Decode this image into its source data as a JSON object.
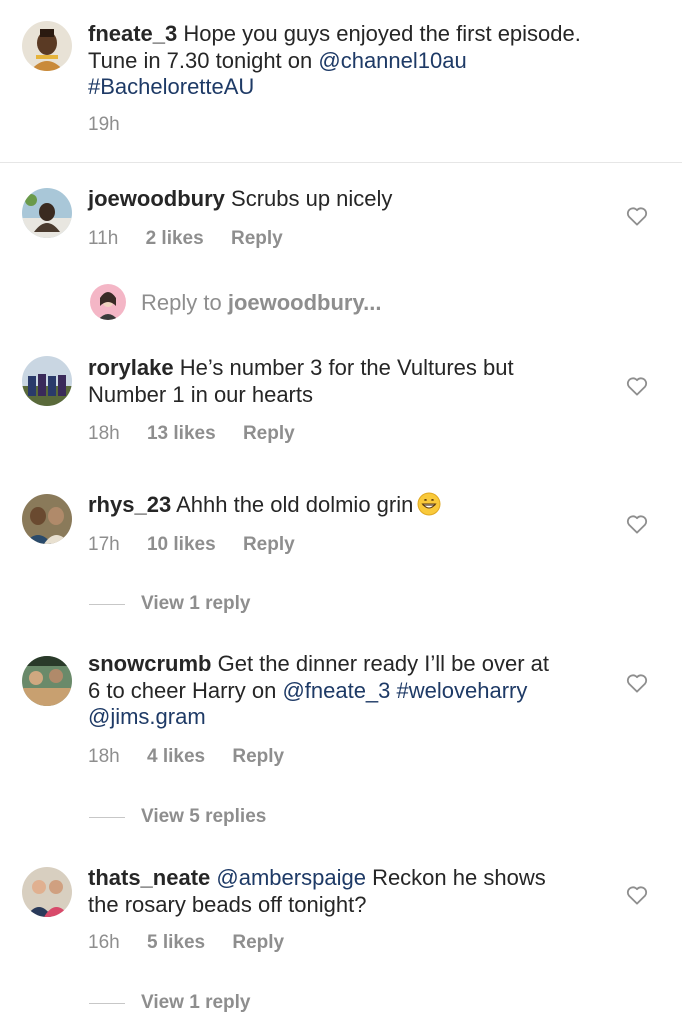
{
  "caption": {
    "username": "fneate_3",
    "text_part1": "Hope you guys enjoyed the first episode.",
    "text_part2": "Tune in 7.30 tonight on",
    "mention": "@channel10au",
    "hashtag": "#BacheloretteAU",
    "time": "19h"
  },
  "comments": [
    {
      "username": "joewoodbury",
      "text": "Scrubs up nicely",
      "time": "11h",
      "likes": "2 likes",
      "reply": "Reply"
    },
    {
      "username": "rorylake",
      "text_line1": "He’s number 3 for the Vultures but",
      "text_line2": "Number 1 in our hearts",
      "time": "18h",
      "likes": "13 likes",
      "reply": "Reply"
    },
    {
      "username": "rhys_23",
      "text": "Ahhh the old dolmio grin",
      "emoji": "grinning-face",
      "time": "17h",
      "likes": "10 likes",
      "reply": "Reply",
      "view_replies": "View 1 reply"
    },
    {
      "username": "snowcrumb",
      "text_line1": "Get the dinner ready I’ll be over at",
      "text_line2a": "6 to cheer Harry on",
      "mention1": "@fneate_3",
      "hashtag": "#weloveharry",
      "mention2": "@jims.gram",
      "time": "18h",
      "likes": "4 likes",
      "reply": "Reply",
      "view_replies": "View 5 replies"
    },
    {
      "username": "thats_neate",
      "mention": "@amberspaige",
      "text_line1": "Reckon he shows",
      "text_line2": "the rosary beads off tonight?",
      "time": "16h",
      "likes": "5 likes",
      "reply": "Reply",
      "view_replies": "View 1 reply"
    }
  ],
  "reply_prompt": {
    "prefix": "Reply to",
    "target": "joewoodbury...",
    "target_bold": "joewoodbury"
  },
  "colors": {
    "text": "#262626",
    "meta": "#8e8e8e",
    "link": "#1e3a66",
    "divider": "#e6e6e6"
  }
}
